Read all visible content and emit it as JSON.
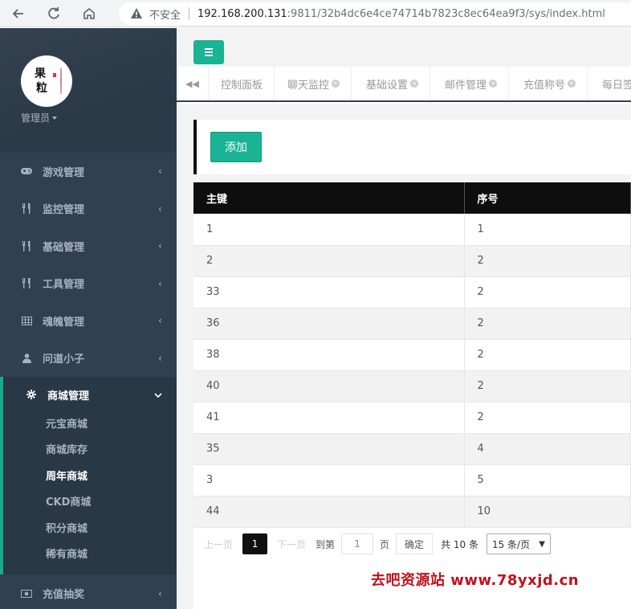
{
  "browser": {
    "security_label": "不安全",
    "url_host": "192.168.200.131",
    "url_rest": ":9811/32b4dc6e4ce74714b7823c8ec64ea9f3/sys/index.html"
  },
  "sidebar": {
    "avatar_text": [
      "果",
      "粒"
    ],
    "role": "管理员",
    "items": [
      {
        "label": "游戏管理",
        "icon": "gamepad-icon"
      },
      {
        "label": "监控管理",
        "icon": "cutlery-icon"
      },
      {
        "label": "基础管理",
        "icon": "cutlery-icon"
      },
      {
        "label": "工具管理",
        "icon": "cutlery-icon"
      },
      {
        "label": "魂魄管理",
        "icon": "table-icon"
      },
      {
        "label": "问道小子",
        "icon": "user-icon"
      }
    ],
    "active_group": {
      "label": "商城管理",
      "icon": "gear-icon",
      "subitems": [
        "元宝商城",
        "商城库存",
        "周年商城",
        "CKD商城",
        "积分商城",
        "稀有商城"
      ],
      "current": "周年商城"
    },
    "after_items": [
      {
        "label": "充值抽奖",
        "icon": "money-icon"
      }
    ]
  },
  "tabs": [
    "控制面板",
    "聊天监控",
    "基础设置",
    "邮件管理",
    "充值称号",
    "每日签"
  ],
  "toolbar": {
    "add_label": "添加"
  },
  "table": {
    "columns": [
      "主键",
      "序号"
    ],
    "rows": [
      [
        "1",
        "1"
      ],
      [
        "2",
        "2"
      ],
      [
        "33",
        "2"
      ],
      [
        "36",
        "2"
      ],
      [
        "38",
        "2"
      ],
      [
        "40",
        "2"
      ],
      [
        "41",
        "2"
      ],
      [
        "35",
        "4"
      ],
      [
        "3",
        "5"
      ],
      [
        "44",
        "10"
      ]
    ]
  },
  "pager": {
    "prev": "上一页",
    "current": "1",
    "next": "下一页",
    "goto": "到第",
    "page_input": "1",
    "page_unit": "页",
    "confirm": "确定",
    "total": "共 10 条",
    "per_page": "15 条/页"
  },
  "watermark": "去吧资源站 www.78yxjd.cn",
  "colors": {
    "accent": "#1ab394",
    "sidebar": "#2f4050",
    "header": "#0e0e0e"
  }
}
